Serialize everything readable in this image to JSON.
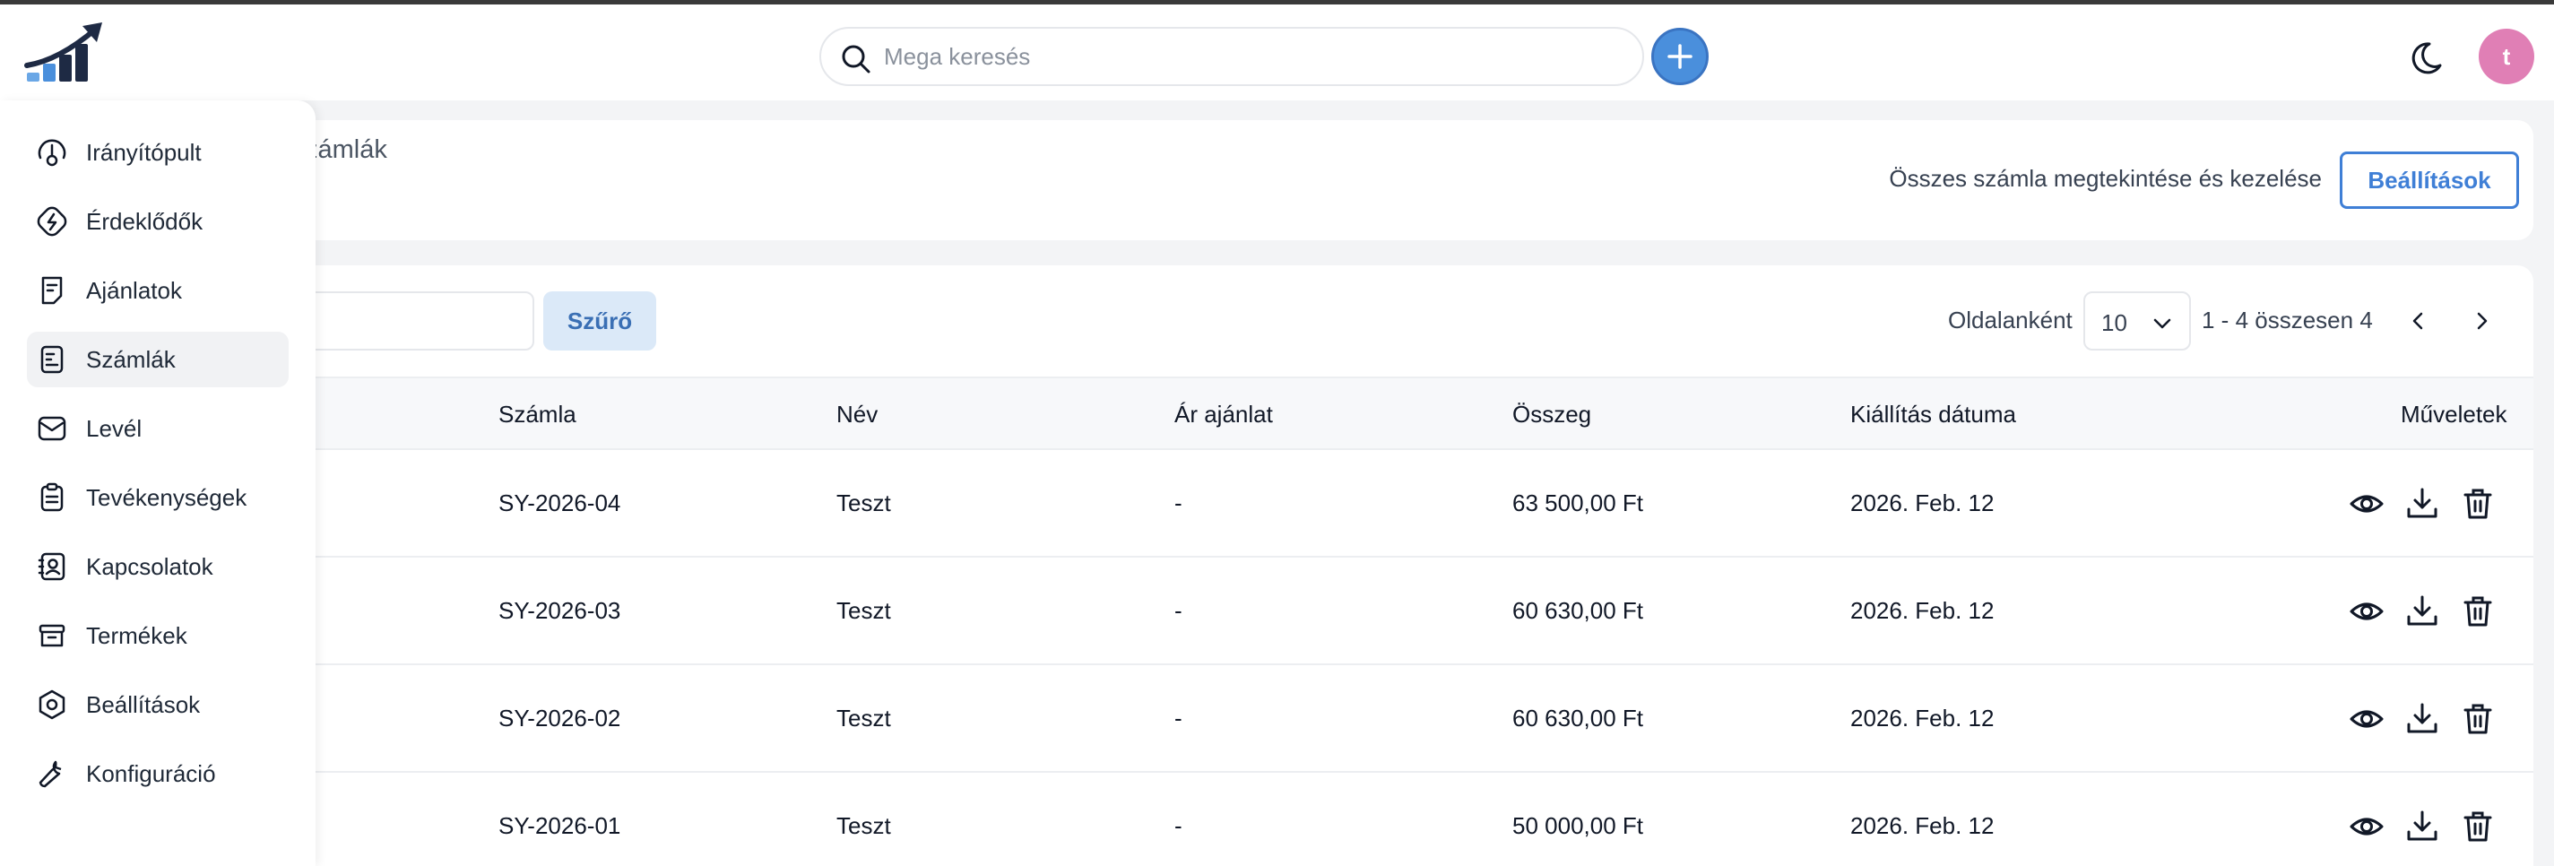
{
  "app": {
    "search_placeholder": "Mega keresés",
    "avatar_letter": "t",
    "accent_color": "#4a8fdc"
  },
  "sidebar": {
    "items": [
      {
        "label": "Irányítópult",
        "icon": "gauge-icon"
      },
      {
        "label": "Érdeklődők",
        "icon": "leads-icon"
      },
      {
        "label": "Ajánlatok",
        "icon": "offer-icon"
      },
      {
        "label": "Számlák",
        "icon": "invoice-icon",
        "active": true
      },
      {
        "label": "Levél",
        "icon": "mail-icon"
      },
      {
        "label": "Tevékenységek",
        "icon": "clipboard-icon"
      },
      {
        "label": "Kapcsolatok",
        "icon": "contacts-icon"
      },
      {
        "label": "Termékek",
        "icon": "archive-icon"
      },
      {
        "label": "Beállítások",
        "icon": "settings-icon"
      },
      {
        "label": "Konfiguráció",
        "icon": "wrench-icon"
      }
    ]
  },
  "header": {
    "title": "zámlák",
    "description": "Összes számla megtekintése és kezelése",
    "settings_label": "Beállítások"
  },
  "toolbar": {
    "filter_label": "Szűrő",
    "per_page_label": "Oldalanként",
    "per_page_value": "10",
    "range_text": "1 - 4 összesen 4"
  },
  "table": {
    "columns": [
      "Számla",
      "Név",
      "Ár ajánlat",
      "Összeg",
      "Kiállítás dátuma",
      "Műveletek"
    ],
    "rows": [
      {
        "invoice": "SY-2026-04",
        "name": "Teszt",
        "offer": "-",
        "amount": "63 500,00 Ft",
        "date": "2026. Feb. 12"
      },
      {
        "invoice": "SY-2026-03",
        "name": "Teszt",
        "offer": "-",
        "amount": "60 630,00 Ft",
        "date": "2026. Feb. 12"
      },
      {
        "invoice": "SY-2026-02",
        "name": "Teszt",
        "offer": "-",
        "amount": "60 630,00 Ft",
        "date": "2026. Feb. 12"
      },
      {
        "invoice": "SY-2026-01",
        "name": "Teszt",
        "offer": "-",
        "amount": "50 000,00 Ft",
        "date": "2026. Feb. 12"
      }
    ]
  }
}
